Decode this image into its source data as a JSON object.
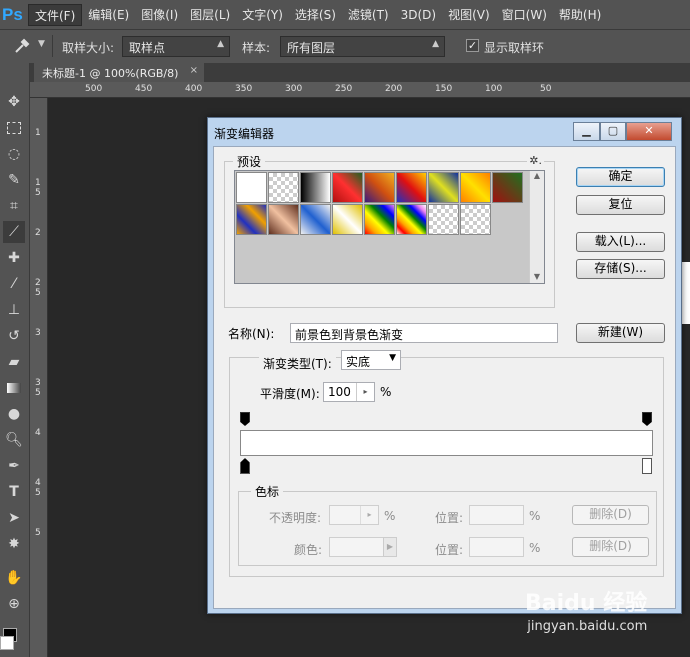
{
  "app": {
    "logo": "Ps"
  },
  "menu": [
    "文件(F)",
    "编辑(E)",
    "图像(I)",
    "图层(L)",
    "文字(Y)",
    "选择(S)",
    "滤镜(T)",
    "3D(D)",
    "视图(V)",
    "窗口(W)",
    "帮助(H)"
  ],
  "options": {
    "sample_size_label": "取样大小:",
    "sample_size_value": "取样点",
    "sample_label": "样本:",
    "sample_value": "所有图层",
    "show_ring_label": "显示取样环",
    "show_ring_checked": true
  },
  "document_tab": {
    "title": "未标题-1 @ 100%(RGB/8)",
    "close": "×"
  },
  "ruler": {
    "top": [
      "500",
      "450",
      "400",
      "350",
      "300",
      "250",
      "200",
      "150",
      "100",
      "50"
    ],
    "left": [
      "1",
      "1 5",
      "2",
      "2 5",
      "3",
      "3 5",
      "4",
      "4 5",
      "5"
    ]
  },
  "dialog": {
    "title": "渐变编辑器",
    "presets_label": "预设",
    "presets_gear": "✲.",
    "ok": "确定",
    "reset": "复位",
    "load": "载入(L)...",
    "save": "存储(S)...",
    "name_label": "名称(N):",
    "name_value": "前景色到背景色渐变",
    "new": "新建(W)",
    "gradient_type_label": "渐变类型(T):",
    "gradient_type_value": "实底",
    "smoothness_label": "平滑度(M):",
    "smoothness_value": "100",
    "smoothness_unit": "%",
    "stops_label": "色标",
    "opacity_label": "不透明度:",
    "opacity_unit": "%",
    "location_label_1": "位置:",
    "location_unit_1": "%",
    "delete_1": "删除(D)",
    "color_label": "颜色:",
    "location_label_2": "位置:",
    "location_unit_2": "%",
    "delete_2": "删除(D)"
  },
  "colors": {
    "accent": "#31a8ff",
    "dialog_frame": "#bcd4ee"
  },
  "watermark": {
    "brand": "Baidu 经验",
    "url": "jingyan.baidu.com"
  }
}
